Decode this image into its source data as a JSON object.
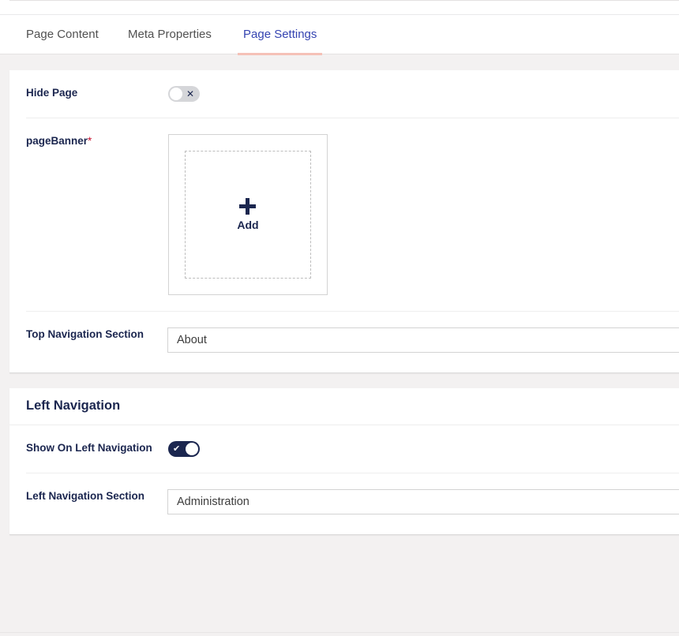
{
  "tabs": [
    {
      "label": "Page Content",
      "active": false
    },
    {
      "label": "Meta Properties",
      "active": false
    },
    {
      "label": "Page Settings",
      "active": true
    }
  ],
  "general": {
    "hide_page": {
      "label": "Hide Page",
      "enabled": false,
      "icon": "x-icon"
    },
    "page_banner": {
      "label": "pageBanner",
      "required_mark": "*",
      "add_label": "Add",
      "icon": "plus-icon"
    },
    "top_navigation": {
      "label": "Top Navigation Section",
      "value": "About"
    }
  },
  "left_navigation": {
    "title": "Left Navigation",
    "show_on_left": {
      "label": "Show On Left Navigation",
      "enabled": true,
      "icon": "check-icon"
    },
    "section": {
      "label": "Left Navigation Section",
      "value": "Administration"
    }
  },
  "colors": {
    "accent": "#1b264f",
    "active_tab_text": "#3544b1",
    "active_tab_underline": "#f5c1b7",
    "required": "#c8102e"
  }
}
